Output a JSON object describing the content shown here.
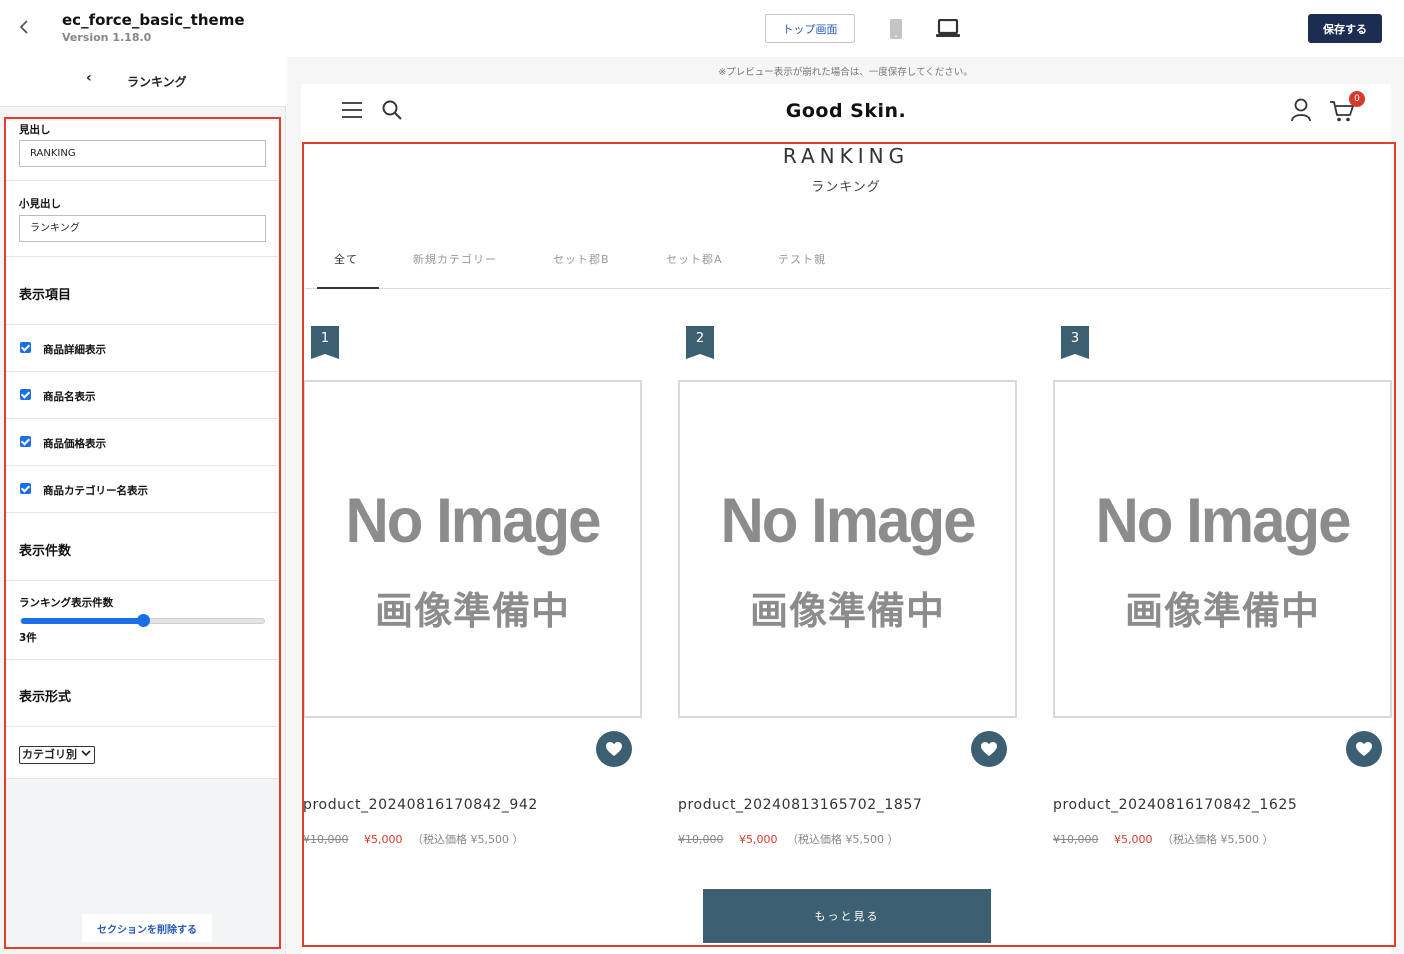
{
  "topbar": {
    "theme_name": "ec_force_basic_theme",
    "theme_version": "Version 1.18.0",
    "top_screen_label": "トップ画面",
    "save_label": "保存する"
  },
  "sidebar": {
    "back_glyph": "‹",
    "title": "ランキング",
    "heading_label": "見出し",
    "heading_value": "RANKING",
    "subheading_label": "小見出し",
    "subheading_value": "ランキング",
    "display_items_heading": "表示項目",
    "checkboxes": [
      {
        "label": "商品詳細表示",
        "checked": true
      },
      {
        "label": "商品名表示",
        "checked": true
      },
      {
        "label": "商品価格表示",
        "checked": true
      },
      {
        "label": "商品カテゴリー名表示",
        "checked": true
      }
    ],
    "count_heading": "表示件数",
    "ranking_count_label": "ランキング表示件数",
    "ranking_count_value": "3件",
    "slider_fraction": 0.5,
    "format_heading": "表示形式",
    "format_selected": "カテゴリ別",
    "delete_label": "セクションを削除する"
  },
  "preview": {
    "note": "※プレビュー表示が崩れた場合は、一度保存してください。",
    "logo": "Good Skin.",
    "cart_count": "0",
    "ranking_title": "RANKING",
    "ranking_subtitle": "ランキング",
    "tabs": [
      "全て",
      "新規カテゴリー",
      "セット郡B",
      "セット郡A",
      "テスト親"
    ],
    "active_tab": 0,
    "no_image_en": "No Image",
    "no_image_jp": "画像準備中",
    "products": [
      {
        "rank": "1",
        "name": "product_20240816170842_942",
        "old_price": "¥10,000",
        "price": "¥5,000",
        "tax": "（税込価格 ¥5,500 ）"
      },
      {
        "rank": "2",
        "name": "product_20240813165702_1857",
        "old_price": "¥10,000",
        "price": "¥5,000",
        "tax": "（税込価格 ¥5,500 ）"
      },
      {
        "rank": "3",
        "name": "product_20240816170842_1625",
        "old_price": "¥10,000",
        "price": "¥5,000",
        "tax": "（税込価格 ¥5,500 ）"
      }
    ],
    "more_label": "もっと見る"
  },
  "colors": {
    "accent": "#3d5f72",
    "save_button": "#1d2d52",
    "price_red": "#d63a2a",
    "highlight_frame": "#e0402a",
    "checkbox_blue": "#1a6ee8"
  }
}
